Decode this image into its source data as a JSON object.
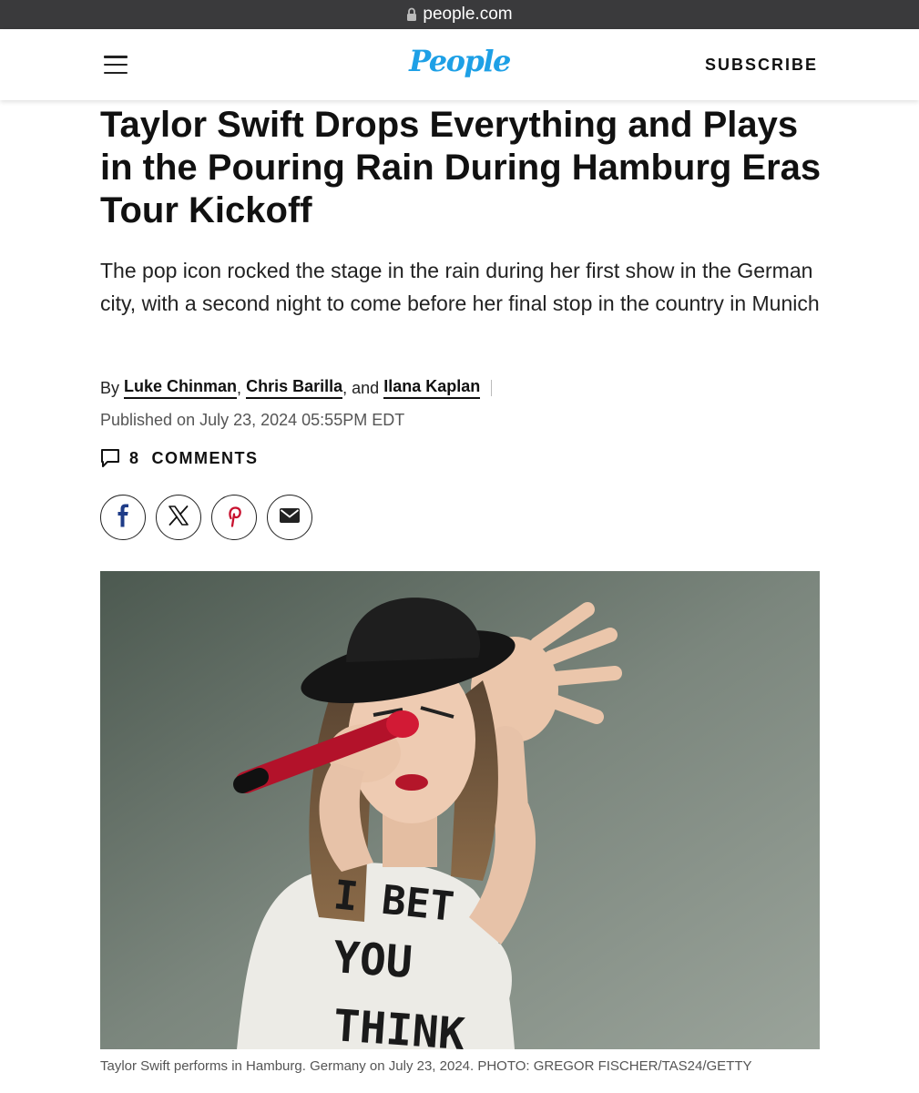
{
  "browser": {
    "domain": "people.com"
  },
  "header": {
    "logo_text": "People",
    "subscribe_label": "SUBSCRIBE"
  },
  "article": {
    "headline": "Taylor Swift Drops Everything and Plays in the Pouring Rain During Hamburg Eras Tour Kickoff",
    "dek": "The pop icon rocked the stage in the rain during her first show in the German city, with a second night to come before her final stop in the country in Munich",
    "byline": {
      "prefix": "By",
      "authors": [
        "Luke Chinman",
        "Chris Barilla",
        "Ilana Kaplan"
      ],
      "sep1": ",",
      "sep2": ", and"
    },
    "published": "Published on July 23, 2024 05:55PM EDT",
    "comments": {
      "count": "8",
      "label": "COMMENTS"
    },
    "share_icons": [
      "facebook-icon",
      "x-icon",
      "pinterest-icon",
      "email-icon"
    ],
    "photo": {
      "shirt_lines": [
        "I BET",
        "YOU",
        "THINK"
      ],
      "caption": "Taylor Swift performs in Hamburg. Germany on July 23, 2024. PHOTO: GREGOR FISCHER/TAS24/GETTY"
    }
  },
  "colors": {
    "brand": "#1ea0e6",
    "browser_bar": "#3a3a3c",
    "text": "#111111",
    "muted": "#555555",
    "pinterest": "#c8102e",
    "facebook": "#1f3c88"
  }
}
